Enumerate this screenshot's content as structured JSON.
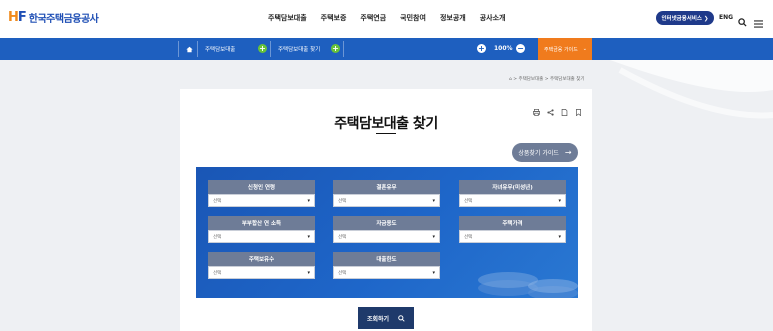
{
  "header": {
    "logo_mark_h": "H",
    "logo_mark_f": "F",
    "logo_text": "한국주택금융공사",
    "nav": [
      "주택담보대출",
      "주택보증",
      "주택연금",
      "국민참여",
      "정보공개",
      "공사소개"
    ],
    "service_button": "인터넷금융서비스 ❯",
    "lang": "ENG"
  },
  "navbar": {
    "home_icon": "home-icon",
    "crumb1": "주택담보대출",
    "crumb2": "주택담보대출 찾기",
    "zoom_in": "+",
    "zoom_value": "100%",
    "zoom_out": "−",
    "guide_tab": "주택금융 가이드"
  },
  "breadcrumb": "⌂ > 주택담보대출 > 주택담보대출 찾기",
  "page": {
    "title": "주택담보대출 찾기",
    "guide_button": "상품찾기 가이드",
    "search_button": "조회하기"
  },
  "filters": [
    {
      "label": "신청인 연령",
      "value": "선택"
    },
    {
      "label": "결혼유무",
      "value": "선택"
    },
    {
      "label": "자녀유무(미성년)",
      "value": "선택"
    },
    {
      "label": "부부합산 연 소득",
      "value": "선택"
    },
    {
      "label": "자금용도",
      "value": "선택"
    },
    {
      "label": "주택가격",
      "value": "선택"
    },
    {
      "label": "주택보유수",
      "value": "선택"
    },
    {
      "label": "대출한도",
      "value": "선택"
    }
  ],
  "colors": {
    "brand_blue": "#1e5fbf",
    "navy": "#1f3a6b",
    "orange": "#f07b1d",
    "label_gray": "#6e7c97"
  }
}
